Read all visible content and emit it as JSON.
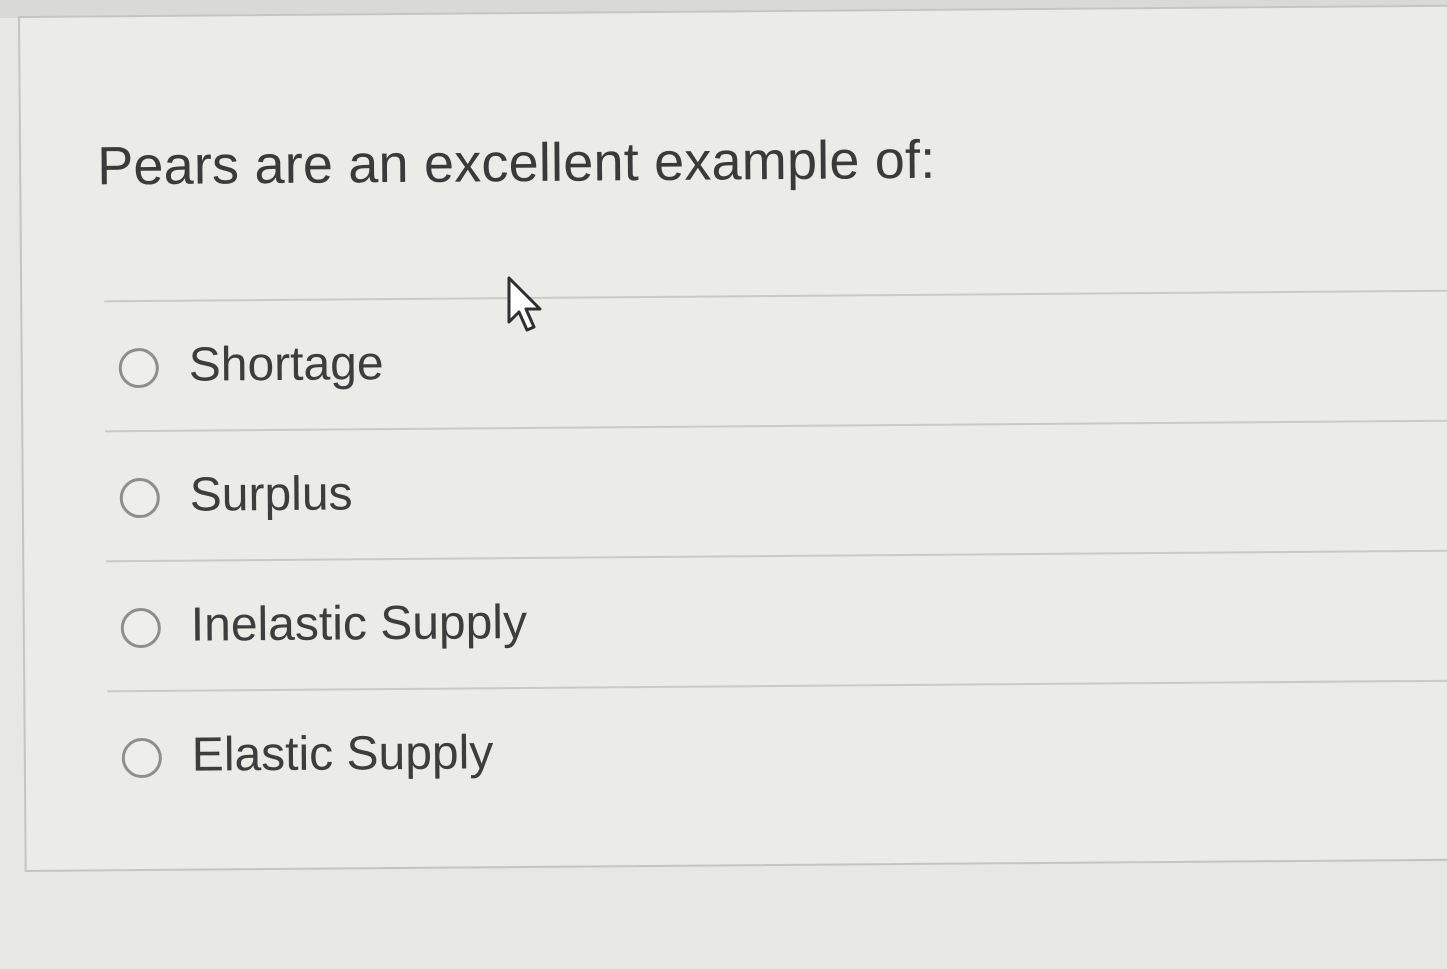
{
  "question": {
    "text": "Pears are an excellent example of:"
  },
  "answers": [
    {
      "label": "Shortage",
      "selected": false
    },
    {
      "label": "Surplus",
      "selected": false
    },
    {
      "label": "Inelastic Supply",
      "selected": false
    },
    {
      "label": "Elastic Supply",
      "selected": false
    }
  ],
  "icons": {
    "cursor": "mouse-cursor-icon"
  }
}
